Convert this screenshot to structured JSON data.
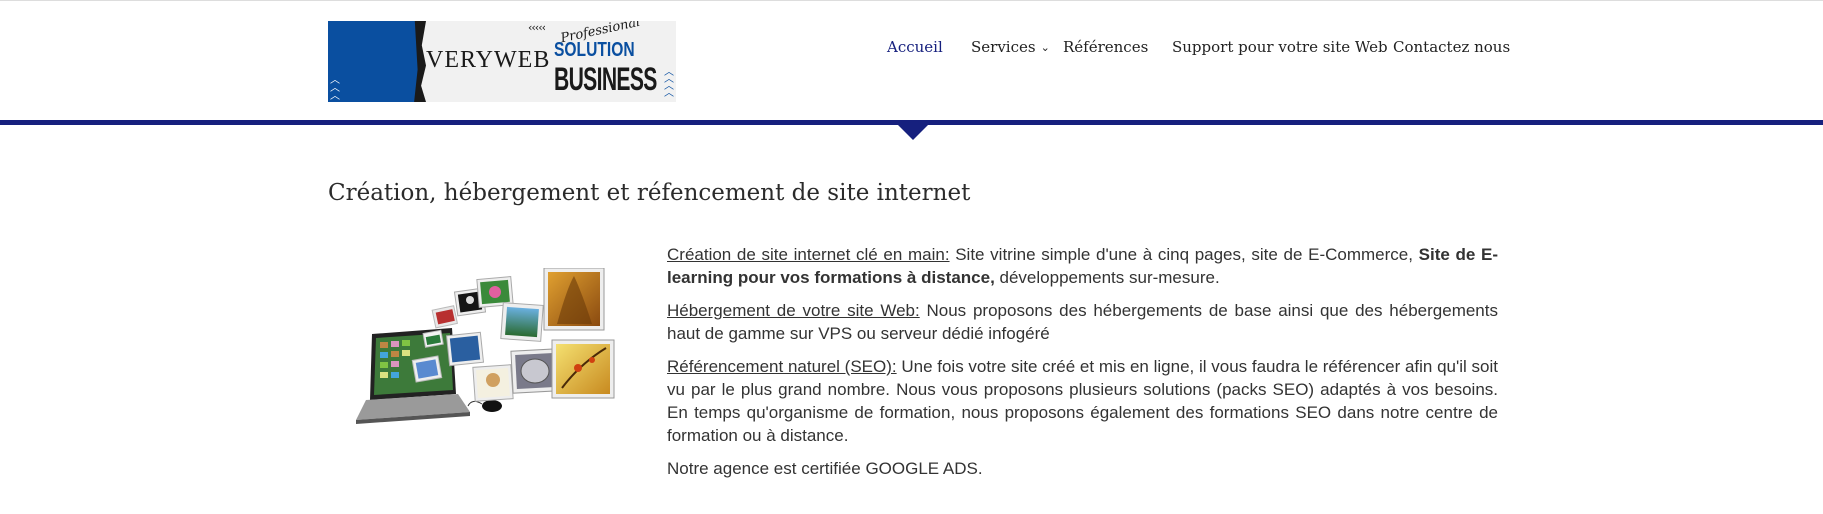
{
  "logo": {
    "brand": "VERYWEB",
    "tagline_script": "Professional",
    "tagline_1": "SOLUTION",
    "tagline_2": "BUSINESS",
    "chevrons_top": "‹‹‹‹‹",
    "chevrons_side": "︿",
    "colors": {
      "blue": "#0a4fa0",
      "dark": "#1a1a1a"
    }
  },
  "nav": {
    "items": [
      {
        "label": "Accueil",
        "active": true
      },
      {
        "label": "Services",
        "has_submenu": true
      },
      {
        "label": "Références"
      },
      {
        "label": "Support pour votre site Web"
      },
      {
        "label": "Contactez nous"
      }
    ],
    "submenu_icon": "chevron-down-icon",
    "active_color": "#16207e"
  },
  "main": {
    "title": "Création, hébergement et réfencement de site internet",
    "paragraphs": {
      "creation": {
        "lead": "Création de site internet clé en main:",
        "text_1": " Site vitrine simple d'une à cinq pages, site de E-Commerce, ",
        "bold": "Site de E-learning pour vos formations à distance,",
        "text_2": " développements sur-mesure."
      },
      "hebergement": {
        "lead": "Hébergement de votre site Web:",
        "text": " Nous proposons des hébergements de base ainsi que des hébergements haut de gamme sur VPS ou serveur dédié infogéré"
      },
      "seo": {
        "lead": "Référencement naturel (SEO):",
        "text": " Une fois votre site créé et mis en ligne, il vous faudra le référencer afin qu'il soit vu par le plus grand nombre. Nous vous proposons plusieurs solutions (packs SEO) adaptés à vos besoins. En temps qu'organisme de formation, nous proposons également des formations SEO dans notre centre de formation ou à distance."
      },
      "certif": "Notre agence est certifiée GOOGLE ADS."
    }
  },
  "theme": {
    "accent": "#16207e"
  }
}
